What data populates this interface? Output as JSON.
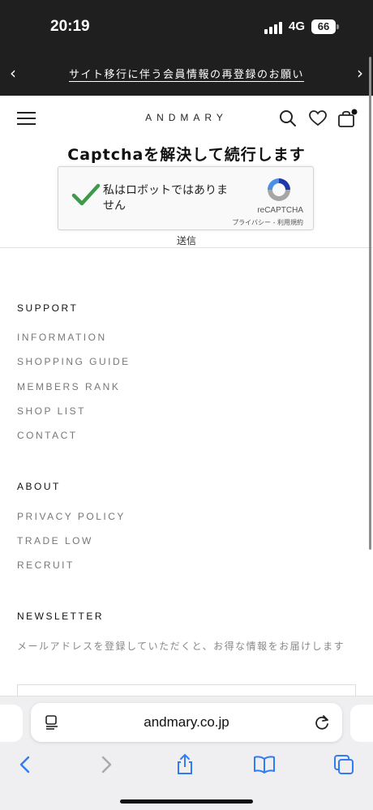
{
  "status": {
    "time": "20:19",
    "network": "4G",
    "battery": "66"
  },
  "announcement": {
    "text": "サイト移行に伴う会員情報の再登録のお願い"
  },
  "header": {
    "logo": "ANDMARY"
  },
  "captcha": {
    "title": "Captchaを解決して続行します",
    "checkbox_label": "私はロボットではありません",
    "brand": "reCAPTCHA",
    "links": "プライバシー - 利用規約",
    "submit_label": "送信"
  },
  "footer": {
    "support": {
      "title": "SUPPORT",
      "links": [
        "INFORMATION",
        "SHOPPING GUIDE",
        "MEMBERS RANK",
        "SHOP LIST",
        "CONTACT"
      ]
    },
    "about": {
      "title": "ABOUT",
      "links": [
        "PRIVACY POLICY",
        "TRADE LOW",
        "RECRUIT"
      ]
    },
    "newsletter": {
      "title": "NEWSLETTER",
      "description": "メールアドレスを登録していただくと、お得な情報をお届けします"
    }
  },
  "browser": {
    "url": "andmary.co.jp"
  },
  "icons": {
    "menu": "hamburger-menu-icon",
    "search": "search-icon",
    "wishlist": "heart-icon",
    "cart": "shopping-bag-icon",
    "check": "checkmark-icon",
    "recaptcha": "recaptcha-logo-icon",
    "reader": "reader-mode-icon",
    "reload": "reload-icon",
    "back": "back-arrow-icon",
    "forward": "forward-arrow-icon",
    "share": "share-icon",
    "bookmarks": "bookmarks-icon",
    "tabs": "tabs-icon"
  },
  "colors": {
    "dark_bar": "#1f1f1f",
    "check_green": "#3c9a4a",
    "text_muted": "#777777"
  }
}
